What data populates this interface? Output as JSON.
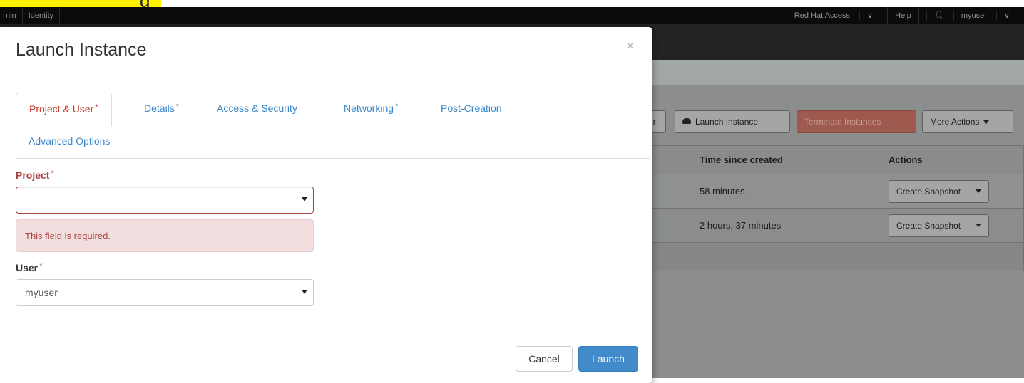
{
  "topnav": {
    "left_items": [
      "nin",
      "Identity"
    ],
    "right_items": {
      "access": "Red Hat Access",
      "help": "Help",
      "user": "myuser"
    }
  },
  "background": {
    "buttons": {
      "partial_label": "er",
      "launch_label": "Launch Instance",
      "terminate_label": "Terminate Instances",
      "more_label": "More Actions"
    },
    "table": {
      "headers": [
        "Time since created",
        "Actions"
      ],
      "rows": [
        {
          "time": "58 minutes",
          "action": "Create Snapshot"
        },
        {
          "time": "2 hours, 37 minutes",
          "action": "Create Snapshot"
        }
      ]
    }
  },
  "modal": {
    "title": "Launch Instance",
    "close_glyph": "×",
    "tabs": [
      {
        "label": "Project & User",
        "required": "*"
      },
      {
        "label": "Details",
        "required": "*"
      },
      {
        "label": "Access & Security",
        "required": ""
      },
      {
        "label": "Networking",
        "required": "*"
      },
      {
        "label": "Post-Creation",
        "required": ""
      },
      {
        "label": "Advanced Options",
        "required": ""
      }
    ],
    "project": {
      "label": "Project",
      "required": "*",
      "value": "",
      "error": "This field is required."
    },
    "user": {
      "label": "User",
      "required": "*",
      "value": "myuser"
    },
    "footer": {
      "cancel": "Cancel",
      "launch": "Launch"
    }
  },
  "colors": {
    "link_blue": "#3a87c8",
    "error_red": "#a94442",
    "error_bg": "#f2dede",
    "primary": "#428bca",
    "highlight": "#fff200"
  }
}
